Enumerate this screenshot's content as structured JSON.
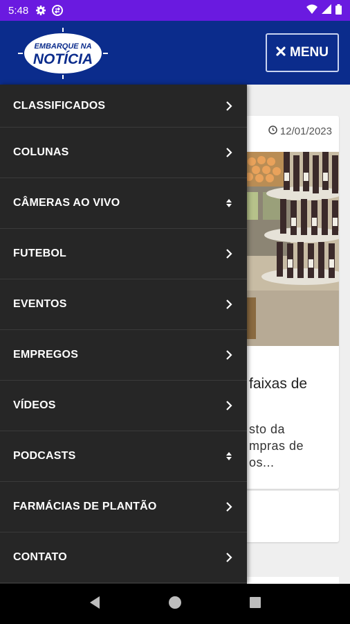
{
  "status_bar": {
    "time": "5:48",
    "left_icons": [
      "gear-icon",
      "sync-icon"
    ],
    "right_icons": [
      "wifi-icon",
      "signal-icon",
      "battery-icon"
    ]
  },
  "header": {
    "logo_line1": "EMBARQUE NA",
    "logo_line2": "NOTÍCIA",
    "menu_label": "MENU",
    "background": "#0b2c8c"
  },
  "drawer": {
    "items": [
      {
        "label": "CLASSIFICADOS",
        "icon": "chevron-right-icon"
      },
      {
        "label": "COLUNAS",
        "icon": "chevron-right-icon"
      },
      {
        "label": "CÂMERAS AO VIVO",
        "icon": "sort-icon"
      },
      {
        "label": "FUTEBOL",
        "icon": "chevron-right-icon"
      },
      {
        "label": "EVENTOS",
        "icon": "chevron-right-icon"
      },
      {
        "label": "EMPREGOS",
        "icon": "chevron-right-icon"
      },
      {
        "label": "VÍDEOS",
        "icon": "chevron-right-icon"
      },
      {
        "label": "PODCASTS",
        "icon": "sort-icon"
      },
      {
        "label": "FARMÁCIAS DE PLANTÃO",
        "icon": "chevron-right-icon"
      },
      {
        "label": "CONTATO",
        "icon": "chevron-right-icon"
      }
    ]
  },
  "article": {
    "date": "12/01/2023",
    "title_fragment": "faixas de",
    "text_line1": "sto da",
    "text_line2": "mpras de",
    "text_line3": "os..."
  },
  "nav_bar": {
    "buttons": [
      "back-icon",
      "home-icon",
      "recents-icon"
    ]
  }
}
